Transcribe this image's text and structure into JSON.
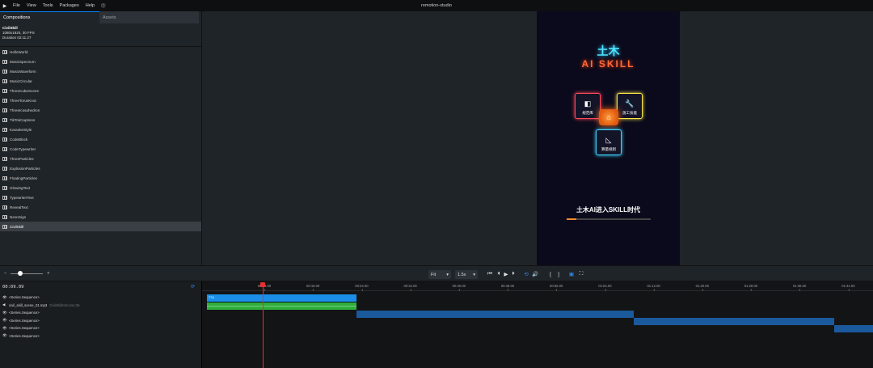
{
  "menubar": {
    "logo_glyph": "▶",
    "items": [
      "File",
      "View",
      "Tools",
      "Packages",
      "Help",
      "⓵"
    ],
    "title": "remotion-studio"
  },
  "sidebar": {
    "tabs": {
      "compositions": "Compositions",
      "assets": "Assets"
    },
    "current": {
      "name": "CivilSkill",
      "dims": "1080x1920, 30 FPS",
      "duration": "Duration 02:11.27"
    },
    "compositions": [
      "HelloWorld",
      "MusicSpectrum",
      "MusicWaveform",
      "MusicCircular",
      "ThreeCubeScene",
      "ThreeTorusKnot",
      "ThreeIcosahedron",
      "TikTokCaptions",
      "KaraokeStyle",
      "CodeBlock",
      "CodeTypewriter",
      "ThreeParticles",
      "ExplosionParticles",
      "FloatingParticles",
      "GlowingText",
      "TypewriterText",
      "RevealText",
      "NeonSign",
      "CivilSkill"
    ],
    "selected_index": 18
  },
  "preview": {
    "title_cn": "土木",
    "title_en": "AI SKILL",
    "cards": {
      "library": {
        "label": "规范库",
        "glyph": "◧"
      },
      "tech": {
        "label": "施工技能",
        "glyph": "🔧"
      },
      "rule": {
        "label": "算量规则",
        "glyph": "◺"
      }
    },
    "house_glyph": "⌂",
    "tagline": "土木AI进入SKILL时代",
    "progress": 0.12
  },
  "toolbar": {
    "zoom_minus": "−",
    "zoom_plus": "+",
    "zoom_level": 0.3,
    "fit_value": "Fit",
    "speed_value": "1.5x",
    "dropdown_glyph": "▾",
    "controls": {
      "skip_start": "⏮",
      "step_back": "⏴",
      "play": "▶",
      "step_fwd": "⏵",
      "loop": "⟲",
      "volume": "🔊",
      "in_mark": "[",
      "out_mark": "]",
      "checkerboard": "▣",
      "fullscreen": "⛶"
    }
  },
  "timeline": {
    "timecode": "00:09.09",
    "loop_glyph": "⟳",
    "ticks": [
      "00:08.00",
      "00:16.00",
      "00:24.00",
      "00:32.00",
      "00:40.00",
      "00:48.00",
      "00:56.00",
      "01:04.00",
      "01:12.00",
      "01:20.00",
      "01:28.00",
      "01:36.00",
      "01:44.00"
    ],
    "tracks": [
      {
        "eye": "👁",
        "label": "<Series.Sequence>",
        "sub": ""
      },
      {
        "eye": "◀",
        "label": "civil_skill_scene_01.mp3",
        "sub": "CivilSkillIntro.tsx:36"
      },
      {
        "eye": "👁",
        "label": "<Series.Sequence>",
        "sub": ""
      },
      {
        "eye": "👁",
        "label": "<Series.Sequence>",
        "sub": ""
      },
      {
        "eye": "👁",
        "label": "<Series.Sequence>",
        "sub": ""
      },
      {
        "eye": "👁",
        "label": "<Series.Sequence>",
        "sub": ""
      }
    ],
    "sequence_label": "774",
    "colors": {
      "blue": "#1b8fe8",
      "green": "#2fae3c",
      "dark_blue": "#1a5a9c",
      "playhead": "#e53030"
    }
  }
}
